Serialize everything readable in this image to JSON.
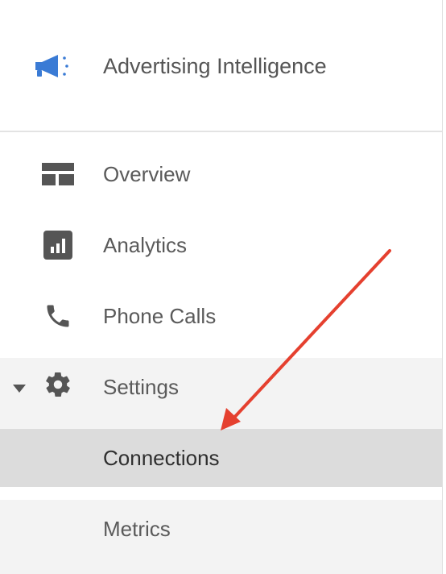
{
  "header": {
    "title": "Advertising Intelligence",
    "icon": "megaphone-icon",
    "brand_color": "#3a7bd5"
  },
  "nav": {
    "items": [
      {
        "label": "Overview",
        "icon": "layout-grid-icon"
      },
      {
        "label": "Analytics",
        "icon": "bar-chart-icon"
      },
      {
        "label": "Phone Calls",
        "icon": "phone-icon"
      },
      {
        "label": "Settings",
        "icon": "gear-icon",
        "expanded": true,
        "children": [
          {
            "label": "Connections",
            "active": true
          },
          {
            "label": "Metrics",
            "active": false
          }
        ]
      }
    ]
  },
  "annotation": {
    "type": "arrow",
    "color": "#e5402f",
    "points_to": "Connections"
  },
  "colors": {
    "icon": "#555555",
    "text": "#5a5a5a",
    "active_bg": "#dcdcdc",
    "section_bg": "#f3f3f3"
  }
}
